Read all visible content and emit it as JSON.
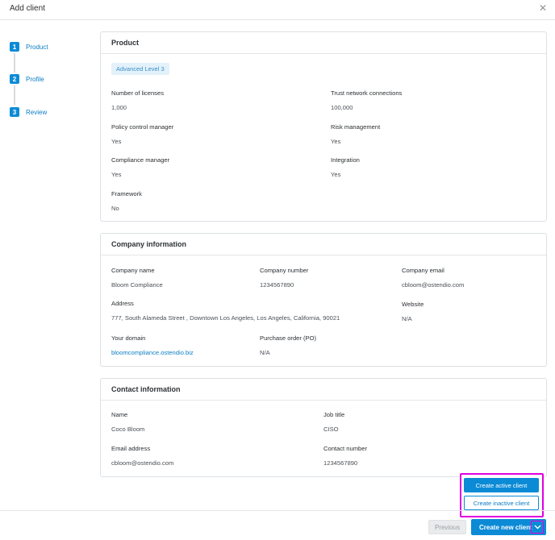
{
  "modal": {
    "title": "Add client",
    "close_icon": "close-icon"
  },
  "steps": [
    {
      "num": "1",
      "label": "Product"
    },
    {
      "num": "2",
      "label": "Profile"
    },
    {
      "num": "3",
      "label": "Review"
    }
  ],
  "product": {
    "header": "Product",
    "badge": "Advanced Level 3",
    "fields": [
      {
        "key": "Number of licenses",
        "value": "1,000"
      },
      {
        "key": "Trust network connections",
        "value": "100,000"
      },
      {
        "key": "Policy control manager",
        "value": "Yes"
      },
      {
        "key": "Risk management",
        "value": "Yes"
      },
      {
        "key": "Compliance manager",
        "value": "Yes"
      },
      {
        "key": "Integration",
        "value": "Yes"
      },
      {
        "key": "Framework",
        "value": "No"
      }
    ]
  },
  "company": {
    "header": "Company information",
    "fields": [
      {
        "key": "Company name",
        "value": "Bloom Compliance"
      },
      {
        "key": "Company number",
        "value": "1234567890"
      },
      {
        "key": "Company email",
        "value": "cbloom@ostendio.com"
      },
      {
        "key": "Address",
        "value": "777, South Alameda Street , Downtown Los Angeles, Los Angeles, California, 90021"
      },
      {
        "key": "Website",
        "value": "N/A"
      },
      {
        "key": "Your domain",
        "value": "bloomcompliance.ostendio.biz"
      },
      {
        "key": "Purchase order (PO)",
        "value": "N/A"
      }
    ]
  },
  "contact": {
    "header": "Contact information",
    "fields": [
      {
        "key": "Name",
        "value": "Coco Bloom"
      },
      {
        "key": "Job title",
        "value": "CISO"
      },
      {
        "key": "Email address",
        "value": "cbloom@ostendio.com"
      },
      {
        "key": "Contact number",
        "value": "1234567890"
      }
    ]
  },
  "footer": {
    "previous_label": "Previous",
    "create_label": "Create new client",
    "dropdown_icon": "chevron-down-icon"
  },
  "dropdown": {
    "active_label": "Create active client",
    "inactive_label": "Create inactive client"
  },
  "colors": {
    "accent": "#0b8bd6",
    "highlight": "#e000e0"
  }
}
